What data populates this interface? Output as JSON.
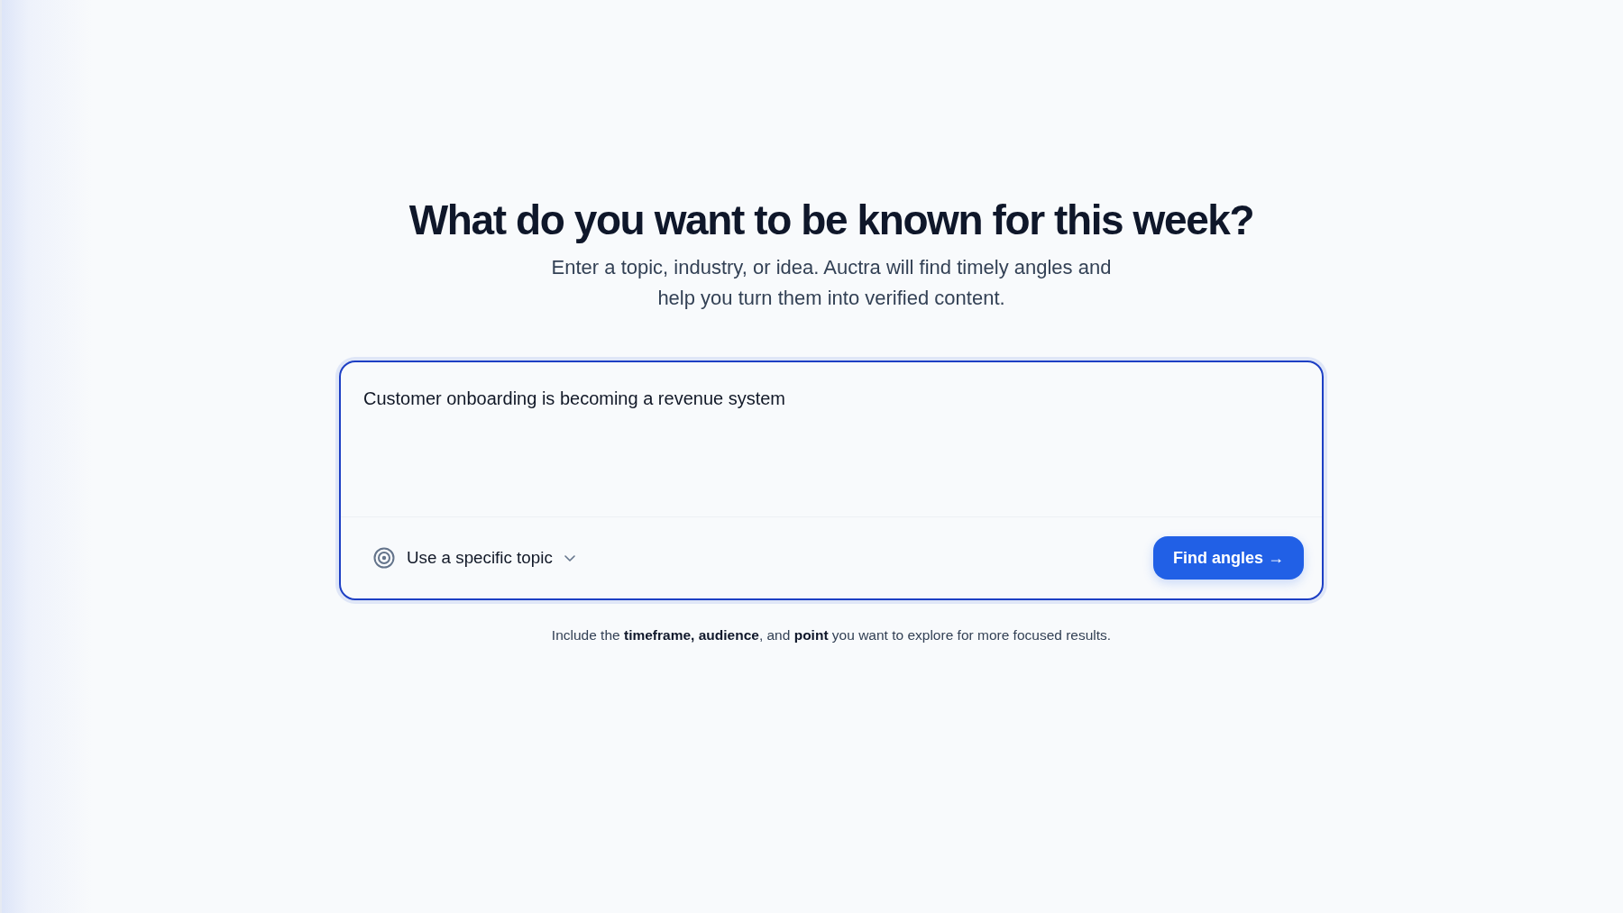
{
  "header": {
    "title": "What do you want to be known for this week?",
    "subtitle": "Enter a topic, industry, or idea. Auctra will find timely angles and help you turn them into verified content."
  },
  "prompt": {
    "value": "Customer onboarding is becoming a revenue system",
    "focused": true,
    "topic_selector": {
      "label": "Use a specific topic"
    },
    "submit_button": {
      "label": "Find angles →"
    }
  },
  "hint": "Include the **timeframe, audience**, and **point** you want to explore for more focused results."
}
